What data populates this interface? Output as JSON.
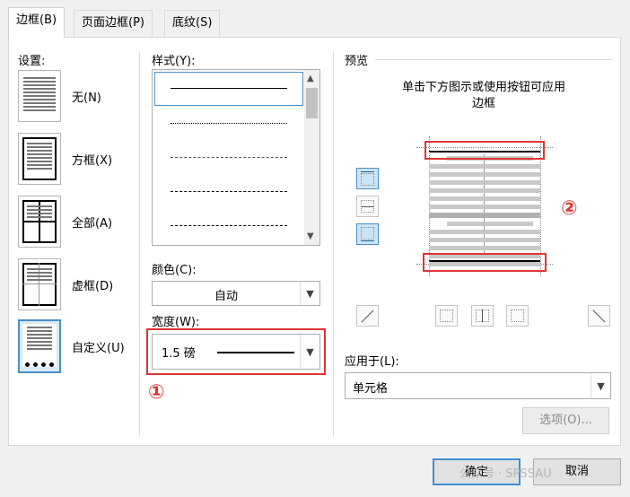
{
  "tabs": [
    {
      "label": "边框(B)"
    },
    {
      "label": "页面边框(P)"
    },
    {
      "label": "底纹(S)"
    }
  ],
  "settings": {
    "title": "设置:",
    "items": [
      {
        "label": "无(N)"
      },
      {
        "label": "方框(X)"
      },
      {
        "label": "全部(A)"
      },
      {
        "label": "虚框(D)"
      },
      {
        "label": "自定义(U)"
      }
    ],
    "selected": "自定义(U)"
  },
  "style": {
    "title": "样式(Y):",
    "line_styles": [
      "solid",
      "dotted",
      "dashed-fine",
      "dashed",
      "dash-dot"
    ],
    "selected": "solid"
  },
  "color": {
    "label": "颜色(C):",
    "value": "自动"
  },
  "width": {
    "label": "宽度(W):",
    "value": "1.5 磅"
  },
  "preview": {
    "title": "预览",
    "hint_line1": "单击下方图示或使用按钮可应用",
    "hint_line2": "边框"
  },
  "apply_to": {
    "label": "应用于(L):",
    "value": "单元格"
  },
  "options_button": "选项(O)...",
  "ok_button": "确定",
  "cancel_button": "取消",
  "annotations": {
    "marker1": "①",
    "marker2": "②"
  },
  "watermark": "公众号 · SPSSAU",
  "colors": {
    "highlight": "#e03535",
    "selection": "#4a90c7"
  }
}
